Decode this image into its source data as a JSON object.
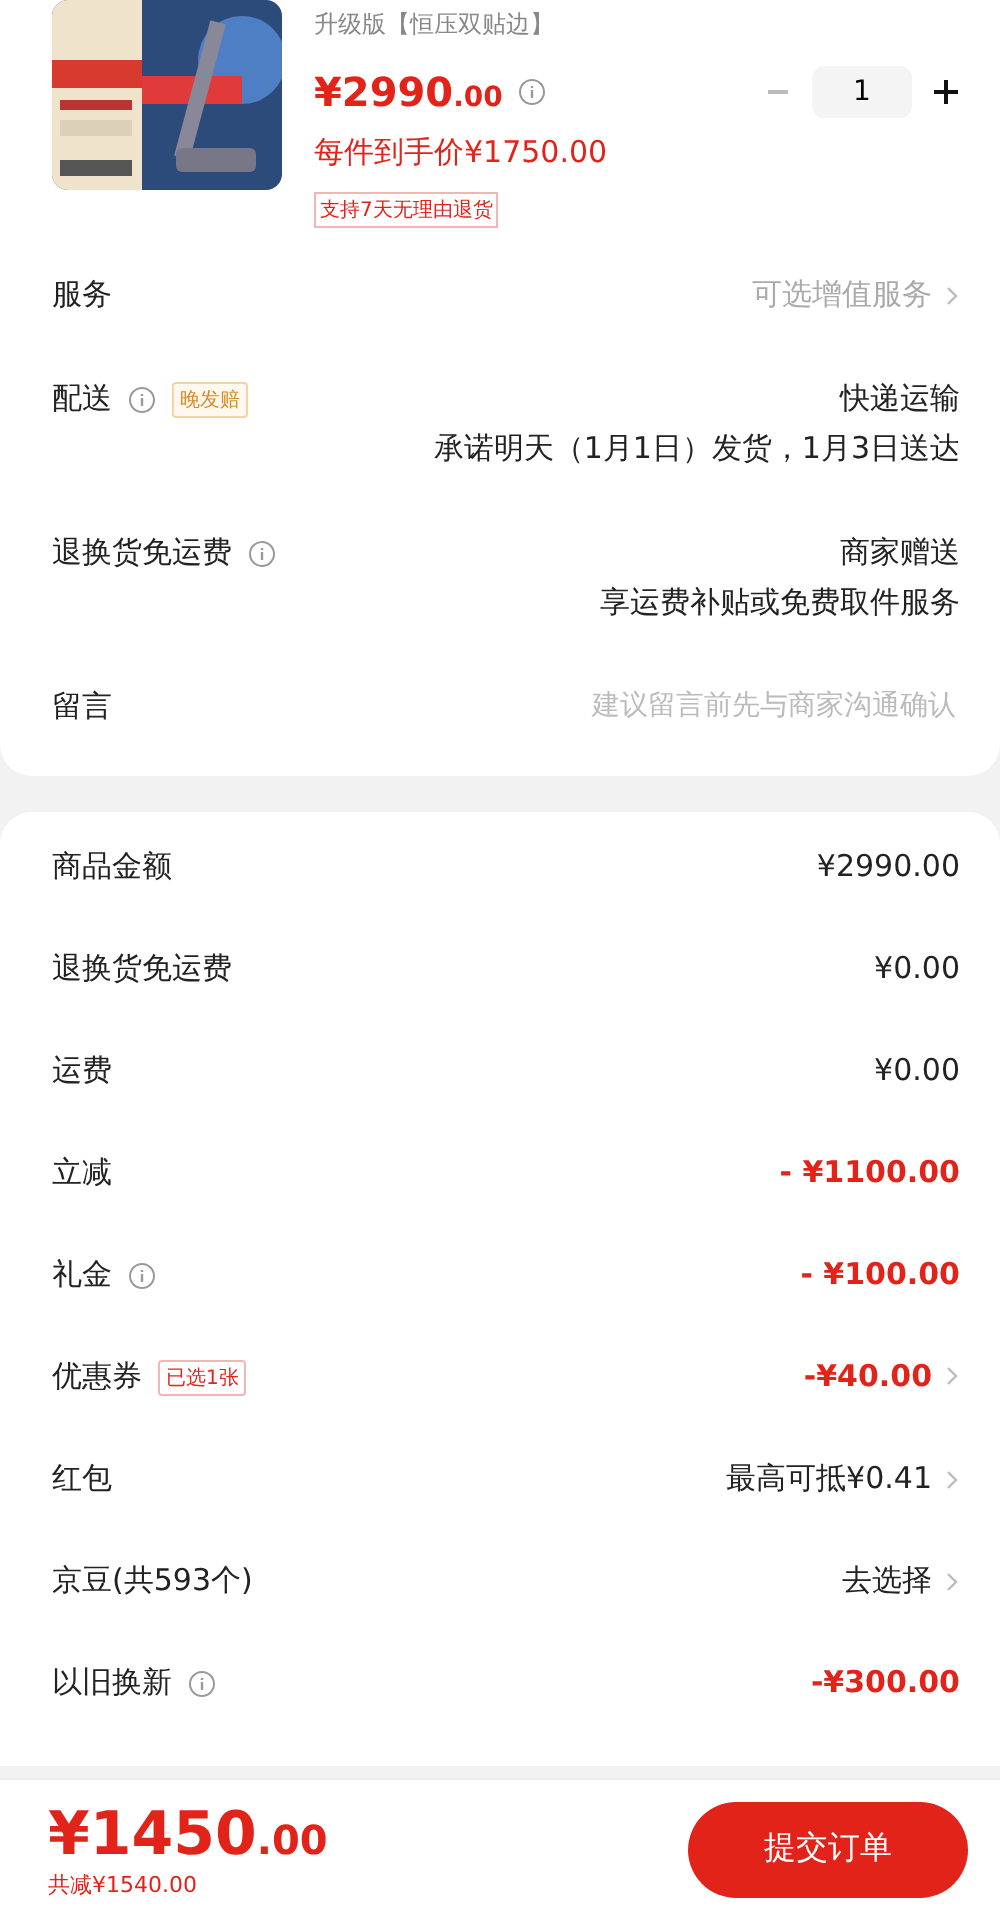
{
  "product": {
    "variant": "升级版【恒压双贴边】",
    "price_main": "¥2990",
    "price_cents": ".00",
    "unit_price": "每件到手价¥1750.00",
    "return_tag": "支持7天无理由退货",
    "quantity": "1"
  },
  "services": [
    {
      "label": "服务",
      "info": false,
      "lines": [
        "可选增值服务"
      ],
      "muted": true,
      "arrow": true
    },
    {
      "label": "配送",
      "info": true,
      "tag": "晚发赔",
      "lines": [
        "快递运输",
        "承诺明天（1月1日）发货，1月3日送达"
      ],
      "muted": false,
      "arrow": false
    },
    {
      "label": "退换货免运费",
      "info": true,
      "lines": [
        "商家赠送",
        "享运费补贴或免费取件服务"
      ],
      "muted": false,
      "arrow": false
    },
    {
      "label": "留言",
      "info": false,
      "placeholder": "建议留言前先与商家沟通确认",
      "arrow": false
    }
  ],
  "summary": [
    {
      "label": "商品金额",
      "info": false,
      "value": "¥2990.00",
      "discount": false,
      "arrow": false
    },
    {
      "label": "退换货免运费",
      "info": false,
      "value": "¥0.00",
      "discount": false,
      "arrow": false
    },
    {
      "label": "运费",
      "info": false,
      "value": "¥0.00",
      "discount": false,
      "arrow": false
    },
    {
      "label": "立减",
      "info": false,
      "value": "- ¥1100.00",
      "discount": true,
      "arrow": false
    },
    {
      "label": "礼金",
      "info": true,
      "value": "- ¥100.00",
      "discount": true,
      "arrow": false
    },
    {
      "label": "优惠券",
      "info": false,
      "tag": "已选1张",
      "value": "-¥40.00",
      "discount": true,
      "arrow": true
    },
    {
      "label": "红包",
      "info": false,
      "value": "最高可抵¥0.41",
      "discount": false,
      "arrow": true
    },
    {
      "label": "京豆(共593个)",
      "info": false,
      "value": "去选择",
      "discount": false,
      "arrow": true
    },
    {
      "label": "以旧换新",
      "info": true,
      "value": "-¥300.00",
      "discount": true,
      "arrow": false
    }
  ],
  "footer": {
    "total_main": "¥1450",
    "total_cents": ".00",
    "saved": "共减¥1540.00",
    "submit": "提交订单"
  }
}
